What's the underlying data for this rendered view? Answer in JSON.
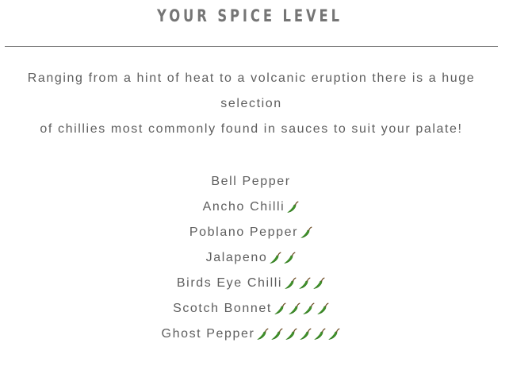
{
  "heading": "YOUR SPICE LEVEL",
  "intro": {
    "line1": "Ranging from a hint of heat to a volcanic eruption there is a huge selection",
    "line2": "of chillies most commonly found in sauces to suit your palate!"
  },
  "levels": [
    {
      "name": "Bell Pepper",
      "chillies": 0
    },
    {
      "name": "Ancho Chilli",
      "chillies": 1
    },
    {
      "name": "Poblano Pepper",
      "chillies": 1
    },
    {
      "name": "Jalapeno",
      "chillies": 2
    },
    {
      "name": "Birds Eye Chilli",
      "chillies": 3
    },
    {
      "name": "Scotch Bonnet",
      "chillies": 4
    },
    {
      "name": "Ghost Pepper",
      "chillies": 6
    }
  ],
  "icon": "hot-pepper-icon",
  "colors": {
    "heading": "#757575",
    "text": "#5e5e5e",
    "divider": "#7a7a7a",
    "chilli": "#3f8f2a",
    "chilli_dark": "#2b6b1c",
    "stem": "#6a4a22"
  }
}
